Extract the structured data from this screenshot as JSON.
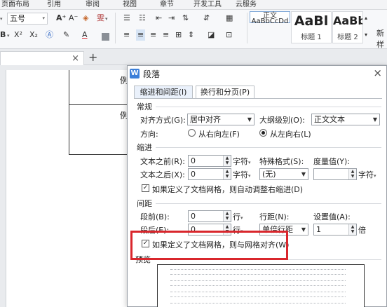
{
  "menu": {
    "items": [
      "页面布局",
      "引用",
      "审阅",
      "视图",
      "章节",
      "开发工具",
      "云服务"
    ]
  },
  "ribbon": {
    "font_size": "五号",
    "grow_font": "A⁺",
    "shrink_font": "A⁻",
    "superscript": "X²",
    "subscript": "X₂",
    "styles": [
      {
        "preview": "AaBbCcDd",
        "name": "正文"
      },
      {
        "preview": "AaBl",
        "name": "标题 1"
      },
      {
        "preview": "AaBb",
        "name": "标题 2"
      }
    ],
    "new_style": "新样"
  },
  "tabstrip": {
    "close": "×",
    "add": "+"
  },
  "document": {
    "cell_1_text": "例",
    "cell_2_text": "例"
  },
  "dialog": {
    "title": "段落",
    "close": "×",
    "tabs": [
      {
        "label": "缩进和间距(I)",
        "active": true
      },
      {
        "label": "换行和分页(P)",
        "active": false
      }
    ],
    "general": {
      "section": "常规",
      "alignment_label": "对齐方式(G):",
      "alignment_value": "居中对齐",
      "outline_label": "大纲级别(O):",
      "outline_value": "正文文本",
      "direction_label": "方向:",
      "rtl_label": "从右向左(F)",
      "ltr_label": "从左向右(L)",
      "direction_selected": "ltr"
    },
    "indent": {
      "section": "缩进",
      "before_label": "文本之前(R):",
      "before_value": "0",
      "before_unit": "字符",
      "after_label": "文本之后(X):",
      "after_value": "0",
      "after_unit": "字符",
      "special_label": "特殊格式(S):",
      "special_value": "(无)",
      "measure_label": "度量值(Y):",
      "measure_value": "",
      "measure_unit": "字符",
      "auto_adjust_label": "如果定义了文档网格，则自动调整右缩进(D)",
      "auto_adjust_checked": true
    },
    "spacing": {
      "section": "间距",
      "before_label": "段前(B):",
      "before_value": "0",
      "before_unit": "行",
      "after_label": "段后(E):",
      "after_value": "0",
      "after_unit": "行",
      "line_label": "行距(N):",
      "line_value": "单倍行距",
      "setting_label": "设置值(A):",
      "setting_value": "1",
      "setting_unit": "倍",
      "grid_label": "如果定义了文档网格，则与网格对齐(W)",
      "grid_checked": true
    },
    "preview": {
      "section": "预览"
    }
  },
  "colors": {
    "highlight_box": "#d9262c",
    "active_tab": "#eaf1fb",
    "logo": "#3c7fd9"
  }
}
